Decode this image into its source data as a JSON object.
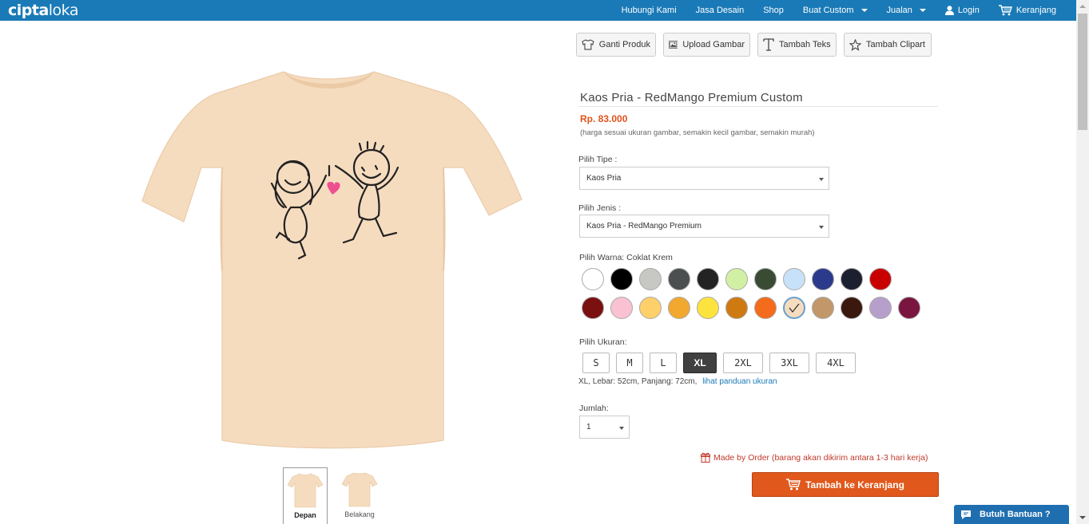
{
  "header": {
    "logo_bold": "cipta",
    "logo_thin": "loka",
    "nav": {
      "contact": "Hubungi Kami",
      "design": "Jasa Desain",
      "shop": "Shop",
      "custom": "Buat Custom",
      "sell": "Jualan",
      "login": "Login",
      "cart": "Keranjang"
    }
  },
  "toolbar": {
    "change_product": "Ganti Produk",
    "upload_image": "Upload Gambar",
    "add_text": "Tambah Teks",
    "add_clipart": "Tambah Clipart"
  },
  "product": {
    "title": "Kaos Pria - RedMango Premium Custom",
    "price": "Rp. 83.000",
    "price_note": "(harga sesuai ukuran gambar, semakin kecil gambar, semakin murah)",
    "shirt_color": "#f6dcbf"
  },
  "views": {
    "front": "Depan",
    "back": "Belakang"
  },
  "options": {
    "type_label": "Pilih Tipe :",
    "type_value": "Kaos Pria",
    "kind_label": "Pilih Jenis :",
    "kind_value": "Kaos Pria - RedMango Premium",
    "color_label": "Pilih Warna:",
    "color_value": "Coklat Krem",
    "colors": [
      "#ffffff",
      "#000000",
      "#c7c8c3",
      "#4c4f4f",
      "#232324",
      "#d2f0a3",
      "#3a4b34",
      "#c7e1f8",
      "#2c3a8c",
      "#1c1f2f",
      "#c90000",
      "#7a1010",
      "#f9c1d2",
      "#fdd06a",
      "#f2a82f",
      "#fde33d",
      "#cf7a11",
      "#f56b1c",
      "#f6dcbf",
      "#c29769",
      "#3a180e",
      "#b79fcb",
      "#7a1540"
    ],
    "selected_color_index": 18,
    "size_label": "Pilih Ukuran:",
    "sizes": [
      "S",
      "M",
      "L",
      "XL",
      "2XL",
      "3XL",
      "4XL"
    ],
    "selected_size": "XL",
    "size_info": "XL, Lebar: 52cm, Panjang: 72cm,",
    "size_guide_link": "lihat panduan ukuran",
    "qty_label": "Jumlah:",
    "qty_value": "1"
  },
  "order_note": "Made by Order (barang akan dikirim antara 1-3 hari kerja)",
  "add_to_cart": "Tambah ke Keranjang",
  "help_button": "Butuh Bantuan ?"
}
